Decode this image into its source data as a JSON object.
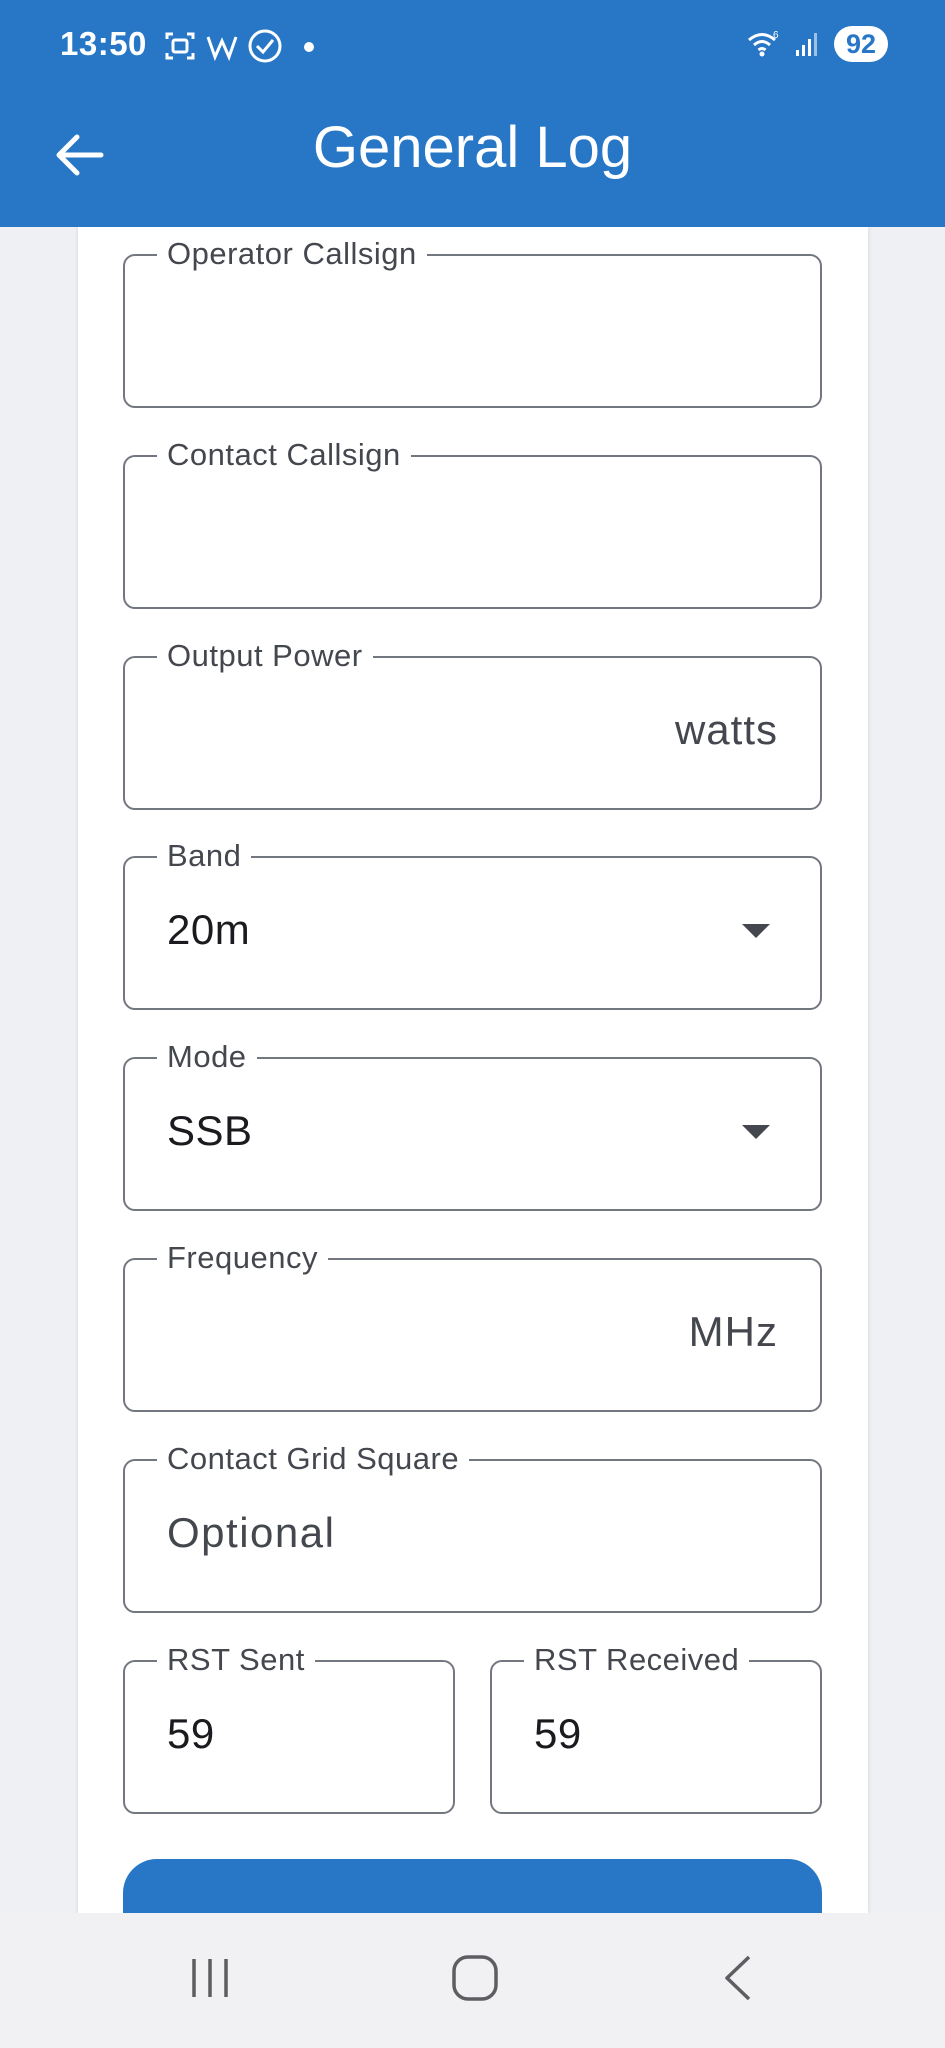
{
  "status_bar": {
    "time": "13:50",
    "battery": "92",
    "icons": [
      "screenshot-icon",
      "w-app-icon",
      "check-circle-icon",
      "dot-icon",
      "wifi-icon",
      "signal-icon"
    ]
  },
  "app_bar": {
    "title": "General Log",
    "back_icon": "arrow-left-icon"
  },
  "form": {
    "operator_callsign": {
      "label": "Operator Callsign",
      "value": ""
    },
    "contact_callsign": {
      "label": "Contact Callsign",
      "value": ""
    },
    "output_power": {
      "label": "Output Power",
      "value": "",
      "suffix": "watts"
    },
    "band": {
      "label": "Band",
      "value": "20m"
    },
    "mode": {
      "label": "Mode",
      "value": "SSB"
    },
    "frequency": {
      "label": "Frequency",
      "value": "",
      "suffix": "MHz"
    },
    "grid_square": {
      "label": "Contact Grid Square",
      "hint": "Optional"
    },
    "rst_sent": {
      "label": "RST Sent",
      "value": "59"
    },
    "rst_received": {
      "label": "RST Received",
      "value": "59"
    }
  },
  "colors": {
    "primary": "#2777c6",
    "outline": "#73777f",
    "label": "#44474e",
    "background": "#eef0f4"
  },
  "nav_bar": {
    "icons": [
      "recent-apps-icon",
      "home-icon",
      "back-icon"
    ]
  }
}
